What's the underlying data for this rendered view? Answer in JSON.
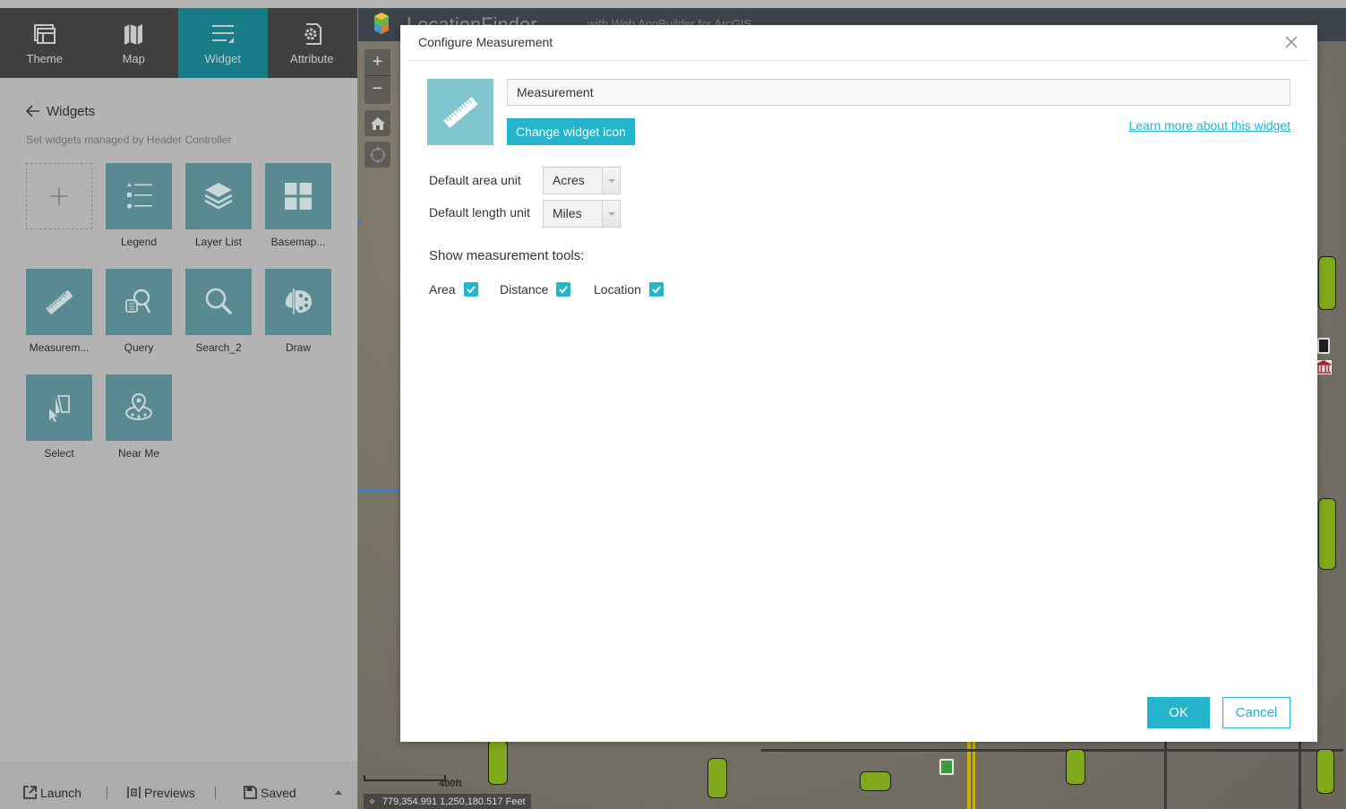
{
  "builder": {
    "tabs": [
      {
        "label": "Theme",
        "icon": "theme-icon",
        "active": false
      },
      {
        "label": "Map",
        "icon": "map-icon",
        "active": false
      },
      {
        "label": "Widget",
        "icon": "widget-icon",
        "active": true
      },
      {
        "label": "Attribute",
        "icon": "attribute-icon",
        "active": false
      }
    ],
    "panel_title": "Widgets",
    "panel_subtitle": "Set widgets managed by Header Controller",
    "widgets": [
      {
        "label": "",
        "icon": "plus-icon"
      },
      {
        "label": "Legend",
        "icon": "legend-icon"
      },
      {
        "label": "Layer List",
        "icon": "layers-icon"
      },
      {
        "label": "Basemap...",
        "icon": "basemap-grid-icon"
      },
      {
        "label": "Measurem...",
        "icon": "ruler-icon"
      },
      {
        "label": "Query",
        "icon": "query-icon"
      },
      {
        "label": "Search_2",
        "icon": "search-icon"
      },
      {
        "label": "Draw",
        "icon": "palette-icon"
      },
      {
        "label": "Select",
        "icon": "select-icon"
      },
      {
        "label": "Near Me",
        "icon": "near-me-icon"
      }
    ],
    "bottom_bar": {
      "launch": "Launch",
      "previews": "Previews",
      "saved": "Saved"
    }
  },
  "map": {
    "app_title": "LocationFinder",
    "app_subtitle": "with Web AppBuilder for ArcGIS",
    "zoom_in": "+",
    "zoom_out": "−",
    "scale_label": "400ft",
    "coordinates": "779,354.991 1,250,180.517 Feet"
  },
  "dialog": {
    "title": "Configure Measurement",
    "widget_name": "Measurement",
    "change_icon_label": "Change widget icon",
    "learn_more_label": "Learn more about this widget",
    "area_unit_label": "Default area unit",
    "area_unit_value": "Acres",
    "length_unit_label": "Default length unit",
    "length_unit_value": "Miles",
    "tools_label": "Show measurement tools:",
    "tools": [
      {
        "label": "Area",
        "checked": true
      },
      {
        "label": "Distance",
        "checked": true
      },
      {
        "label": "Location",
        "checked": true
      }
    ],
    "ok_label": "OK",
    "cancel_label": "Cancel"
  },
  "colors": {
    "accent": "#24b5cc",
    "active_tab": "#187d89",
    "widget_tile": "#5a8a91",
    "icon_preview_bg": "#7fc6cf"
  }
}
